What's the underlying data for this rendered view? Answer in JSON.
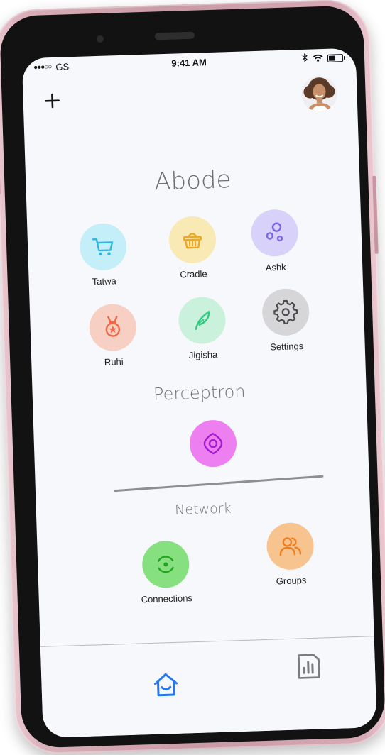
{
  "status_bar": {
    "carrier": "GS",
    "time": "9:41 AM",
    "battery_level": 0.45
  },
  "header": {
    "add_icon": "plus-icon",
    "avatar_icon": "user-avatar"
  },
  "sections": {
    "abode": {
      "title": "Abode",
      "apps": [
        {
          "label": "Tatwa",
          "icon": "cart-icon",
          "bg": "#c4eff9",
          "fg": "#2fb6dd"
        },
        {
          "label": "Cradle",
          "icon": "basket-icon",
          "bg": "#f8e9b5",
          "fg": "#f0a820"
        },
        {
          "label": "Ashk",
          "icon": "bubbles-icon",
          "bg": "#d8d2fa",
          "fg": "#7a66e8"
        },
        {
          "label": "Ruhi",
          "icon": "medal-icon",
          "bg": "#f7cfc3",
          "fg": "#ec6a48"
        },
        {
          "label": "Jigisha",
          "icon": "feather-icon",
          "bg": "#c9f1dc",
          "fg": "#34c983"
        },
        {
          "label": "Settings",
          "icon": "gear-icon",
          "bg": "#d6d6d8",
          "fg": "#4a4a4f"
        }
      ]
    },
    "perceptron": {
      "title": "Perceptron",
      "apps": [
        {
          "label": "",
          "icon": "eye-target-icon",
          "bg": "#ee7ff0",
          "fg": "#a51bd1"
        }
      ]
    },
    "network": {
      "title": "Network",
      "apps": [
        {
          "label": "Connections",
          "icon": "connection-ring-icon",
          "bg": "#86e07f",
          "fg": "#24a521"
        },
        {
          "label": "Groups",
          "icon": "group-icon",
          "bg": "#f7c38e",
          "fg": "#f07d1e"
        }
      ]
    }
  },
  "tab_bar": {
    "tabs": [
      {
        "name": "home",
        "icon": "home-smile-icon",
        "active": true,
        "color": "#2477f2"
      },
      {
        "name": "reports",
        "icon": "bar-chart-document-icon",
        "active": false,
        "color": "#7c7c80"
      }
    ]
  }
}
